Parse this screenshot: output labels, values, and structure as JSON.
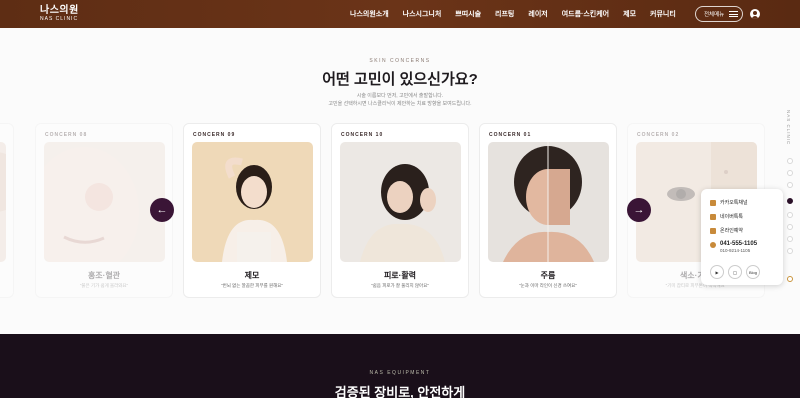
{
  "header": {
    "logo_ko": "나스의원",
    "logo_en": "NAS CLINIC",
    "nav": [
      "나스의원소개",
      "나스시그니처",
      "쁘띠시술",
      "리프팅",
      "레이저",
      "여드름·스킨케어",
      "제모",
      "커뮤니티"
    ],
    "all_menu_label": "전체메뉴",
    "user_icon": "user-circle-icon"
  },
  "concerns": {
    "kicker": "SKIN CONCERNS",
    "title": "어떤 고민이 있으신가요?",
    "desc_line1": "시술 이름보다 먼저, 고민에서 출발합니다.",
    "desc_line2": "고민을 선택하시면 나스클리닉이 제안하는 치료 방향을 보여드립니다.",
    "cards": [
      {
        "code": "CONCERN 08",
        "name": "홍조·혈관",
        "sub": "\"붉은 기가 쉽게 올라와요\""
      },
      {
        "code": "CONCERN 09",
        "name": "제모",
        "sub": "\"번뇌 없는 깔끔한 피부를 원해요\""
      },
      {
        "code": "CONCERN 10",
        "name": "피로·활력",
        "sub": "\"쉽음 피로가 잘 풀리지 않아요\""
      },
      {
        "code": "CONCERN 01",
        "name": "주름",
        "sub": "\"눈과 이마 라인이 신경 쓰여요\""
      },
      {
        "code": "CONCERN 02",
        "name": "색소·기미",
        "sub": "\"기미 잡티로 피부톤이 칙칙해요\""
      }
    ],
    "prev_icon": "arrow-left-icon",
    "next_icon": "arrow-right-icon"
  },
  "quick": {
    "items": [
      "카카오톡채널",
      "네이버톡톡",
      "온라인예약"
    ],
    "phone1": "041-555-1105",
    "phone2": "010-9214-1105",
    "socials": [
      "youtube-icon",
      "instagram-icon",
      "Blog"
    ]
  },
  "pager": {
    "label": "NAS CLINIC"
  },
  "equipment": {
    "kicker": "NAS EQUIPMENT",
    "title": "검증된 장비로, 안전하게"
  },
  "colors": {
    "header_brown": "#5e2d14",
    "accent_plum": "#3a1536",
    "dark_section": "#1a0f1a",
    "gold": "#c88a3a"
  }
}
